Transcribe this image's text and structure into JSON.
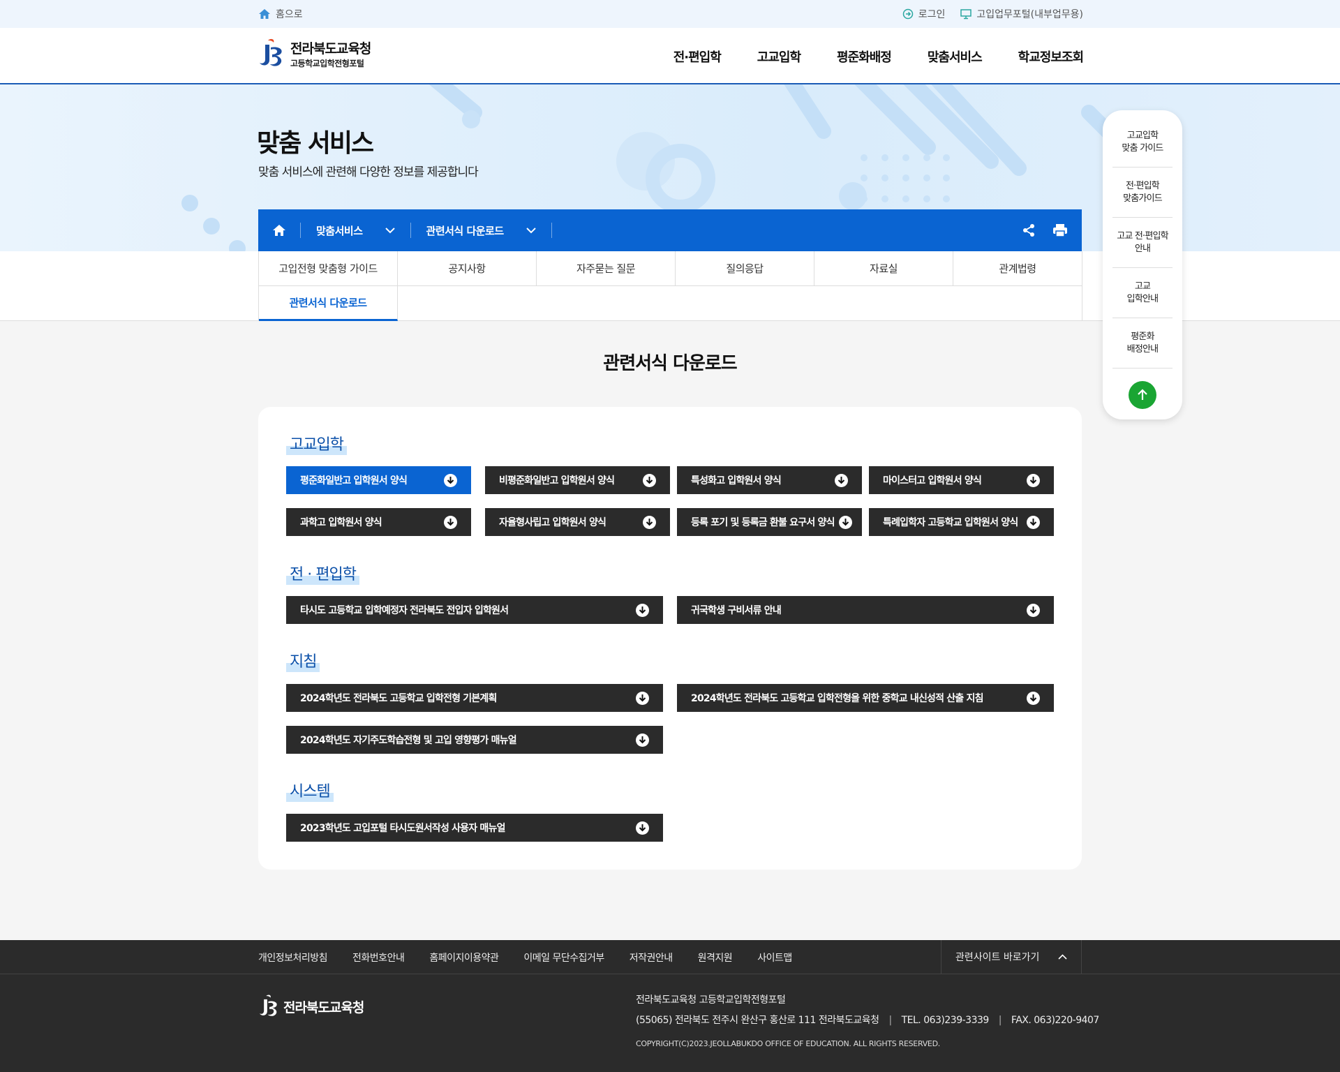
{
  "util": {
    "home": "홈으로",
    "login": "로그인",
    "portal": "고입업무포털(내부업무용)"
  },
  "header": {
    "logo_main": "전라북도교육청",
    "logo_sub": "고등학교입학전형포털",
    "gnb": [
      "전·편입학",
      "고교입학",
      "평준화배정",
      "맞춤서비스",
      "학교정보조회"
    ]
  },
  "hero": {
    "title": "맞춤 서비스",
    "subtitle": "맞춤 서비스에 관련해 다양한 정보를 제공합니다"
  },
  "location": {
    "depth1": "맞춤서비스",
    "depth2": "관련서식 다운로드"
  },
  "tabs": [
    "고입전형 맞춤형 가이드",
    "공지사항",
    "자주묻는 질문",
    "질의응답",
    "자료실",
    "관계법령",
    "관련서식 다운로드"
  ],
  "page_title": "관련서식 다운로드",
  "sections": [
    {
      "title": "고교입학",
      "items": [
        "평준화일반고 입학원서 양식",
        "비평준화일반고 입학원서 양식",
        "특성화고 입학원서 양식",
        "마이스터고 입학원서 양식",
        "과학고 입학원서 양식",
        "자율형사립고 입학원서 양식",
        "등록 포기 및 등록금 환불 요구서 양식",
        "특례입학자 고등학교 입학원서 양식"
      ]
    },
    {
      "title": "전 · 편입학",
      "items": [
        "타시도 고등학교 입학예정자 전라북도 전입자 입학원서",
        "귀국학생 구비서류 안내"
      ]
    },
    {
      "title": "지침",
      "items": [
        "2024학년도 전라북도 고등학교 입학전형 기본계획",
        "2024학년도 전라북도 고등학교 입학전형을 위한 중학교 내신성적 산출 지침",
        "2024학년도 자기주도학습전형 및 고입 영향평가 매뉴얼"
      ]
    },
    {
      "title": "시스템",
      "items": [
        "2023학년도 고입포털 타시도원서작성 사용자 매뉴얼"
      ]
    }
  ],
  "quick_menu": [
    "고교입학\n맞춤 가이드",
    "전·편입학\n맞춤가이드",
    "고교 전·편입학\n안내",
    "고교\n입학안내",
    "평준화\n배정안내"
  ],
  "footer": {
    "links": [
      "개인정보처리방침",
      "전화번호안내",
      "홈페이지이용약관",
      "이메일 무단수집거부",
      "저작권안내",
      "원격지원",
      "사이트맵"
    ],
    "related": "관련사이트 바로가기",
    "logo": "전라북도교육청",
    "org": "전라북도교육청 고등학교입학전형포털",
    "address": "(55065) 전라북도 전주시 완산구 홍산로 111 전라북도교육청",
    "tel": "TEL. 063)239-3339",
    "fax": "FAX. 063)220-9407",
    "copyright": "COPYRIGHT(C)2023.JEOLLABUKDO OFFICE OF EDUCATION. ALL RIGHTS RESERVED."
  },
  "colors": {
    "primary": "#0a64d2",
    "dark": "#2b2b2b",
    "green": "#1aa533"
  }
}
